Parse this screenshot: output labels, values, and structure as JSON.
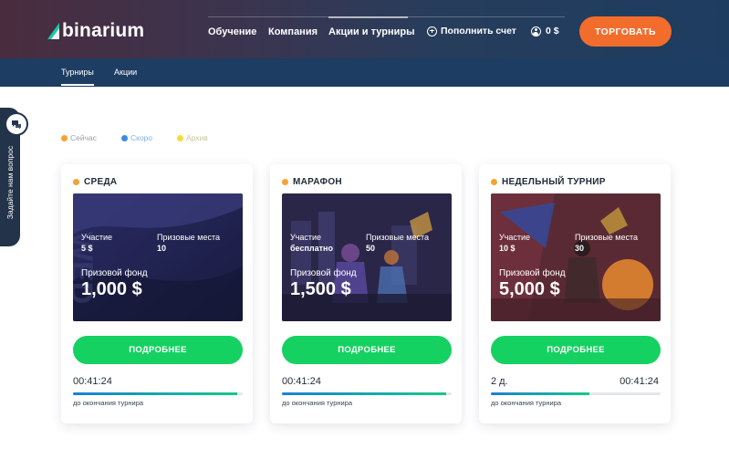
{
  "header": {
    "logo_text": "binarium",
    "nav": {
      "learn": "Обучение",
      "company": "Компания",
      "promo": "Акции и турниры"
    },
    "deposit_label": "Пополнить счет",
    "balance": "0 $",
    "trade_button": "ТОРГОВАТЬ"
  },
  "subnav": {
    "tournaments": "Турниры",
    "promos": "Акции"
  },
  "side_tab": {
    "label": "Задайте нам вопрос"
  },
  "filters": {
    "now": {
      "label": "Сейчас",
      "color": "#f7a233"
    },
    "soon": {
      "label": "Скоро",
      "color": "#3b8de0"
    },
    "archive": {
      "label": "Архив",
      "color": "#f3dc3b"
    }
  },
  "cards": [
    {
      "title": "СРЕДА",
      "participation_label": "Участие",
      "participation_value": "5 $",
      "prize_places_label": "Призовые места",
      "prize_places_value": "10",
      "prize_fund_label": "Призовой фонд",
      "prize_fund_value": "1,000 $",
      "button": "ПОДРОБНЕЕ",
      "timer_days": "",
      "timer": "00:41:24",
      "progress": 0.97,
      "caption": "до окончания турнира"
    },
    {
      "title": "МАРАФОН",
      "participation_label": "Участие",
      "participation_value": "бесплатно",
      "prize_places_label": "Призовые места",
      "prize_places_value": "50",
      "prize_fund_label": "Призовой фонд",
      "prize_fund_value": "1,500 $",
      "button": "ПОДРОБНЕЕ",
      "timer_days": "",
      "timer": "00:41:24",
      "progress": 0.97,
      "caption": "до окончания турнира"
    },
    {
      "title": "НЕДЕЛЬНЫЙ ТУРНИР",
      "participation_label": "Участие",
      "participation_value": "10 $",
      "prize_places_label": "Призовые места",
      "prize_places_value": "30",
      "prize_fund_label": "Призовой фонд",
      "prize_fund_value": "5,000 $",
      "button": "ПОДРОБНЕЕ",
      "timer_days": "2 д.",
      "timer": "00:41:24",
      "progress": 0.58,
      "caption": "до окончания турнира"
    }
  ],
  "colors": {
    "accent_orange": "#f26d2b",
    "accent_green": "#15d161",
    "header_dark": "#1d3d62"
  }
}
